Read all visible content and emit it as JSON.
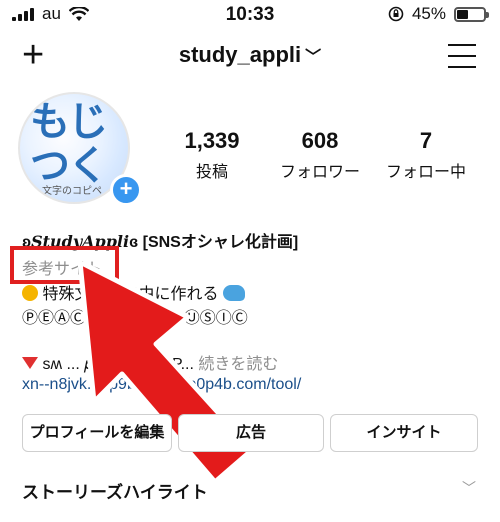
{
  "status_bar": {
    "carrier": "au",
    "time": "10:33",
    "battery": "45%",
    "battery_level": 0.45
  },
  "header": {
    "username": "study_appli",
    "chevron": "﹀"
  },
  "avatar": {
    "text": "もじ\nつく",
    "subtext": "文字のコピペ"
  },
  "stats": [
    {
      "value": "1,339",
      "label": "投稿"
    },
    {
      "value": "608",
      "label": "フォロワー"
    },
    {
      "value": "7",
      "label": "フォロー中"
    }
  ],
  "bio": {
    "name_prefix": "ʚ",
    "name_script": "StudyAppli",
    "name_suffix": "ɞ [SNSオシャレ化計画]",
    "category": "参考サイト",
    "line1": " 特殊文字で自由に作れる ",
    "line2": "ⓅⒺⒶⒸⒺ ⒶⓇⓉ / ⓂⓊⓈⒾⒸ",
    "line3_text": " ѕʍ ... 𝑝𝑖𝑐𝑡𝑢𝑟𝑒 / TRIP...",
    "more": "続きを読む",
    "link": "xn--n8jvk...8p9bzdx320b0p4b.com/tool/"
  },
  "buttons": {
    "edit": "プロフィールを編集",
    "ads": "広告",
    "insights": "インサイト"
  },
  "highlights": {
    "label": "ストーリーズハイライト",
    "chevron": "﹀"
  }
}
